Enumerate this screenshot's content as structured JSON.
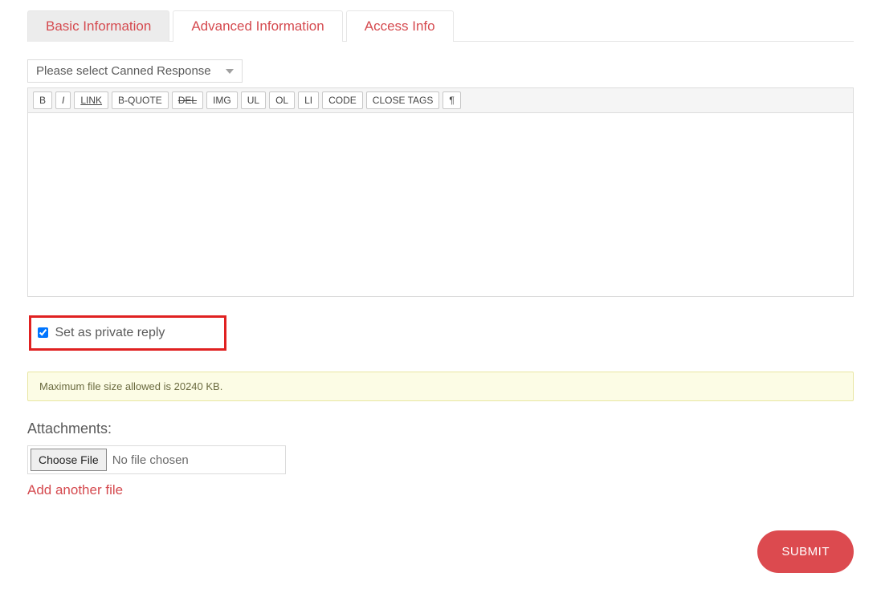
{
  "tabs": {
    "basic": "Basic Information",
    "advanced": "Advanced Information",
    "access": "Access Info"
  },
  "editor": {
    "canned_placeholder": "Please select Canned Response",
    "buttons": {
      "bold": "B",
      "italic": "I",
      "link": "LINK",
      "bquote": "B-QUOTE",
      "del": "DEL",
      "img": "IMG",
      "ul": "UL",
      "ol": "OL",
      "li": "LI",
      "code": "CODE",
      "close": "CLOSE TAGS",
      "pilcrow": "¶"
    },
    "content": ""
  },
  "private": {
    "label": "Set as private reply",
    "checked": true
  },
  "alert": {
    "text": "Maximum file size allowed is 20240 KB."
  },
  "attachments": {
    "heading": "Attachments:",
    "choose_label": "Choose File",
    "no_file": "No file chosen",
    "add_another": "Add another file"
  },
  "submit": {
    "label": "SUBMIT"
  }
}
